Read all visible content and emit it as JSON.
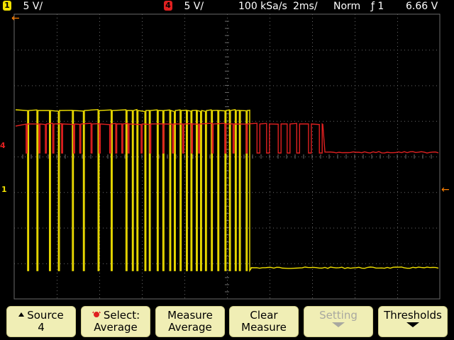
{
  "status_bar": {
    "ch1_badge": "1",
    "ch1_scale": "5 V/",
    "ch4_badge": "4",
    "ch4_scale": "5 V/",
    "sample_rate": "100 kSa/s",
    "timebase": "2ms/",
    "trigger_mode": "Norm",
    "trigger_slope": "ƒ 1",
    "trigger_level": "6.66 V"
  },
  "markers": {
    "trigger_pos": "←",
    "ch1_marker": "1",
    "ch4_marker": "4",
    "right_marker": "←"
  },
  "colors": {
    "ch1": "#f0e000",
    "ch4": "#e02020",
    "grid": "#6a6a6a",
    "trigger": "#ff8000"
  },
  "softkeys": [
    {
      "line1": "Source",
      "line2": "4",
      "arrow_up": true,
      "enabled": true
    },
    {
      "line1": "Select:",
      "line2": "Average",
      "knob": true,
      "enabled": true
    },
    {
      "line1": "Measure",
      "line2": "Average",
      "enabled": true
    },
    {
      "line1": "Clear",
      "line2": "Measure",
      "enabled": true
    },
    {
      "line1": "Setting",
      "line2": "",
      "arrow_down": true,
      "enabled": false
    },
    {
      "line1": "Thresholds",
      "line2": "",
      "arrow_down": true,
      "enabled": true
    }
  ]
}
